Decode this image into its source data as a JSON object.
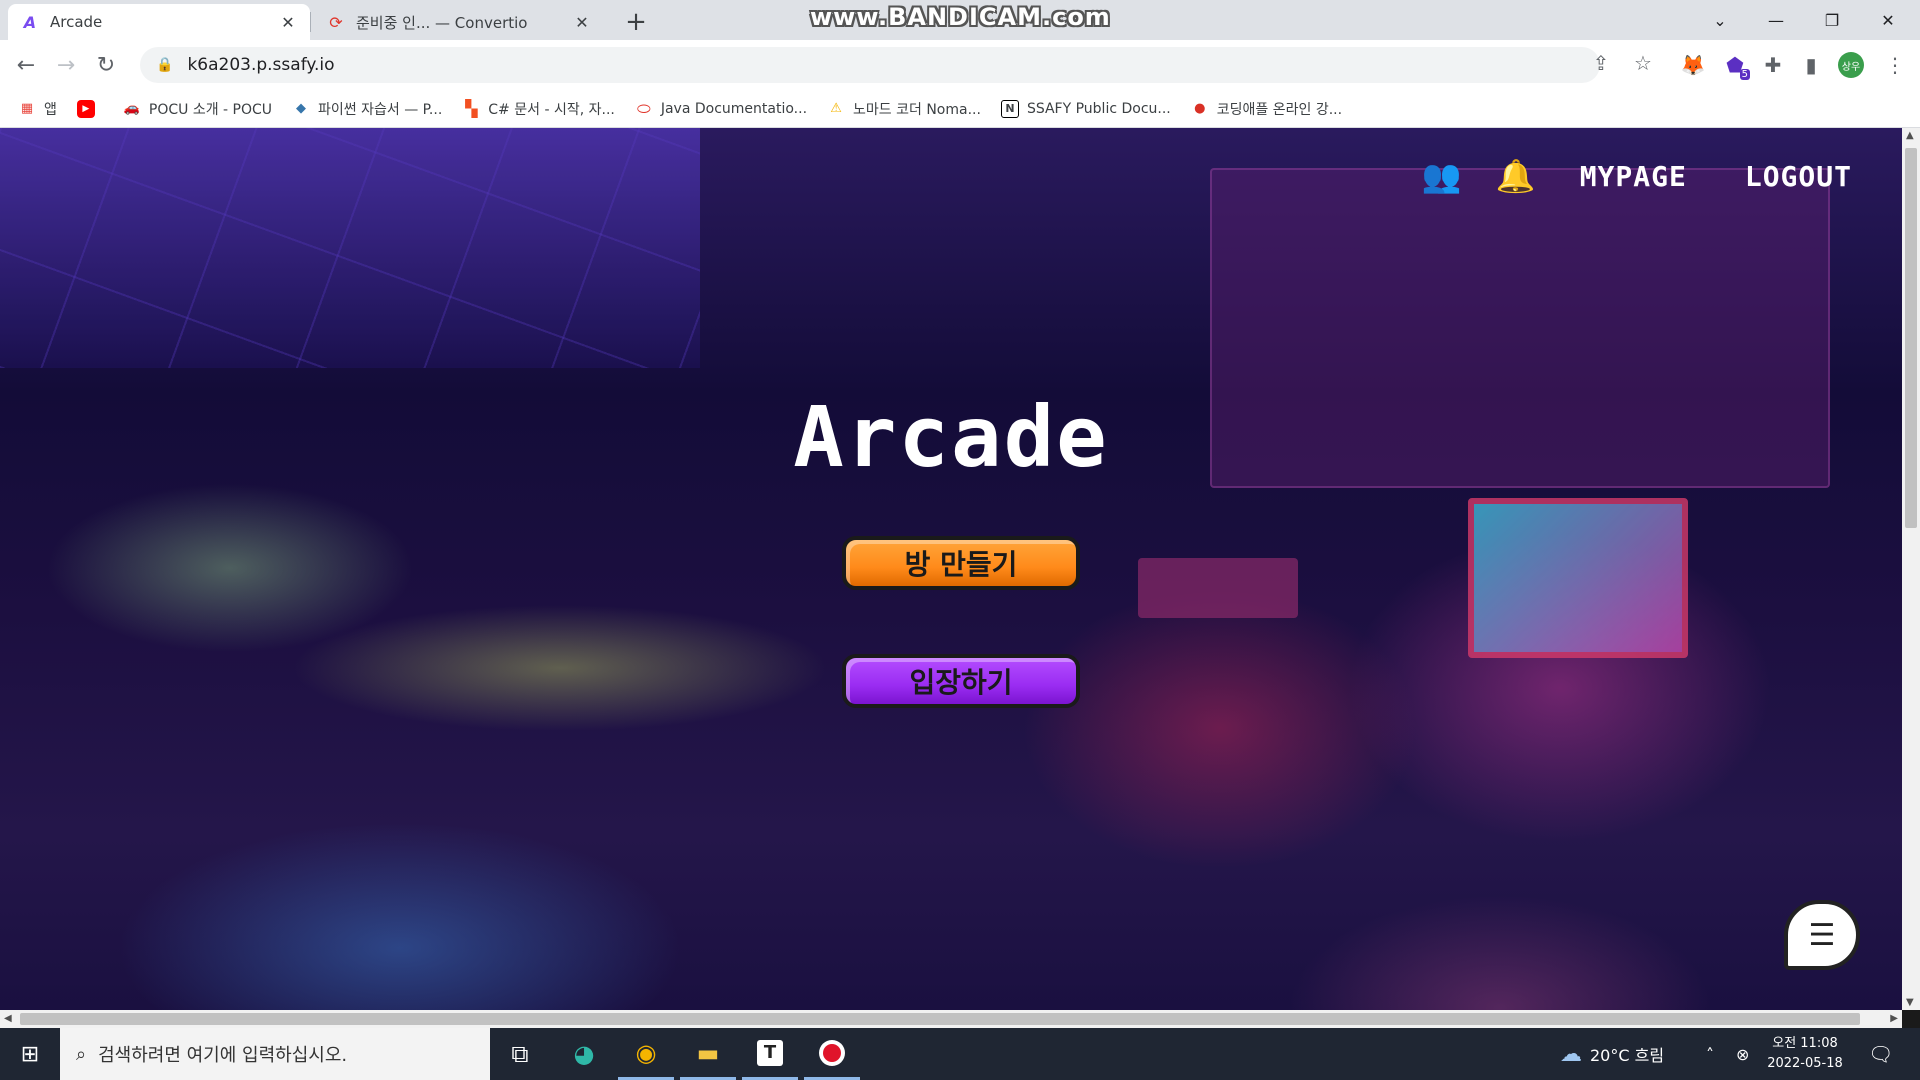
{
  "browser": {
    "tabs": [
      {
        "title": "Arcade",
        "active": true
      },
      {
        "title": "준비중 인... — Convertio",
        "active": false
      }
    ],
    "watermark": "www.BANDICAM.com",
    "url": "k6a203.p.ssafy.io",
    "profile_initial": "상우",
    "extension_badge": "5",
    "bookmarks": [
      {
        "label": "앱",
        "icon": "apps-grid-icon"
      },
      {
        "label": "",
        "icon": "youtube-icon"
      },
      {
        "label": "POCU 소개 - POCU",
        "icon": "pocu-icon"
      },
      {
        "label": "파이썬 자습서 — P...",
        "icon": "python-icon"
      },
      {
        "label": "C# 문서 - 시작, 자...",
        "icon": "microsoft-icon"
      },
      {
        "label": "Java Documentatio...",
        "icon": "oracle-icon"
      },
      {
        "label": "노마드 코더 Noma...",
        "icon": "nomad-icon"
      },
      {
        "label": "SSAFY Public Docu...",
        "icon": "notion-icon"
      },
      {
        "label": "코딩애플 온라인 강...",
        "icon": "apple-fruit-icon"
      }
    ]
  },
  "page": {
    "nav": {
      "mypage": "MYPAGE",
      "logout": "LOGOUT"
    },
    "title": "Arcade",
    "buttons": {
      "create_room": "방 만들기",
      "enter": "입장하기"
    },
    "colors": {
      "create_button": "#ff8a1a",
      "enter_button": "#9a2cf2"
    }
  },
  "taskbar": {
    "search_placeholder": "검색하려면 여기에 입력하십시오.",
    "weather": "20°C 흐림",
    "time": "오전 11:08",
    "date": "2022-05-18"
  }
}
